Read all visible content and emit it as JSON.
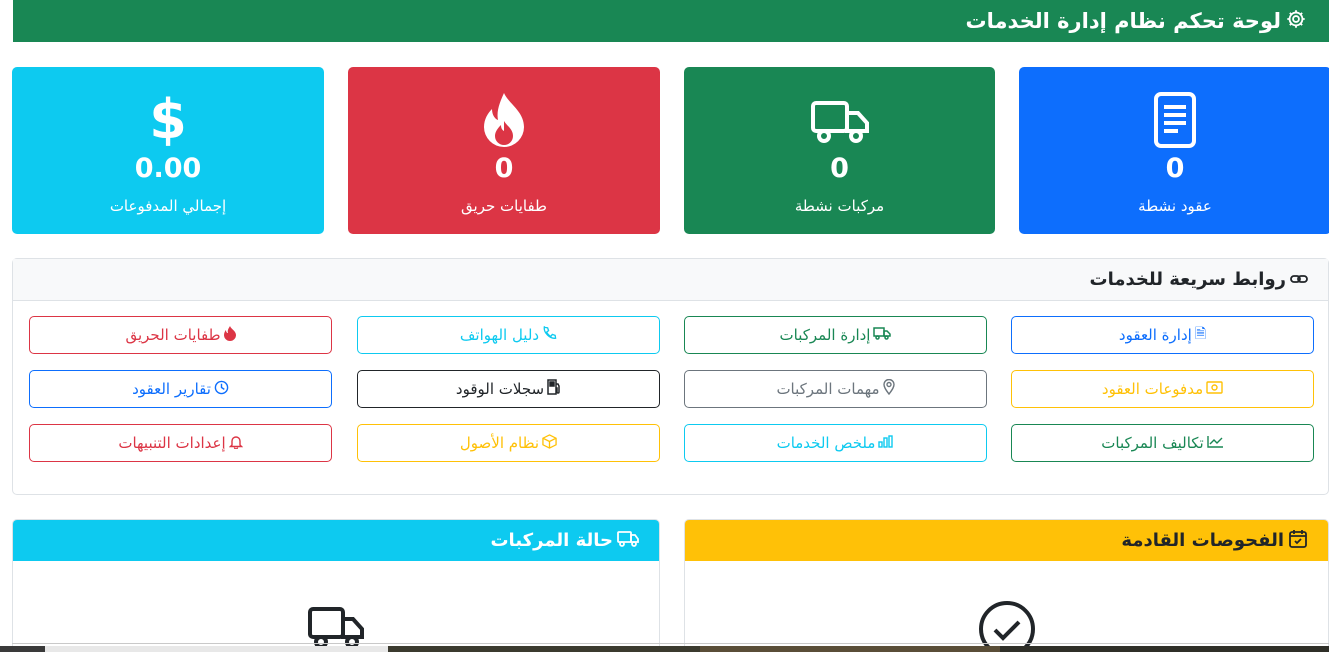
{
  "header": {
    "title": "لوحة تحكم نظام إدارة الخدمات",
    "icon": "gear-icon"
  },
  "stats": [
    {
      "id": "contracts",
      "value": "0",
      "label": "عقود نشطة",
      "icon": "document-icon",
      "color": "#0d6efd"
    },
    {
      "id": "vehicles",
      "value": "0",
      "label": "مركبات نشطة",
      "icon": "truck-icon",
      "color": "#198754"
    },
    {
      "id": "extinguishers",
      "value": "0",
      "label": "طفايات حريق",
      "icon": "fire-icon",
      "color": "#dc3545"
    },
    {
      "id": "payments",
      "value": "0.00",
      "label": "إجمالي المدفوعات",
      "icon": "dollar-icon",
      "color": "#0dcaf0"
    }
  ],
  "quick_links": {
    "title": "روابط سريعة للخدمات",
    "icon": "link-icon",
    "items": [
      {
        "label": "إدارة العقود",
        "icon": "file-text-icon",
        "color": "#0d6efd"
      },
      {
        "label": "إدارة المركبات",
        "icon": "truck-icon",
        "color": "#198754"
      },
      {
        "label": "دليل الهواتف",
        "icon": "phone-icon",
        "color": "#0dcaf0"
      },
      {
        "label": "طفايات الحريق",
        "icon": "fire-icon",
        "color": "#dc3545"
      },
      {
        "label": "مدفوعات العقود",
        "icon": "cash-icon",
        "color": "#ffc107"
      },
      {
        "label": "مهمات المركبات",
        "icon": "map-pin-icon",
        "color": "#6c757d"
      },
      {
        "label": "سجلات الوقود",
        "icon": "fuel-pump-icon",
        "color": "#212529"
      },
      {
        "label": "تقارير العقود",
        "icon": "clock-icon",
        "color": "#0d6efd"
      },
      {
        "label": "تكاليف المركبات",
        "icon": "graph-up-icon",
        "color": "#198754"
      },
      {
        "label": "ملخص الخدمات",
        "icon": "bar-chart-icon",
        "color": "#0dcaf0"
      },
      {
        "label": "نظام الأصول",
        "icon": "box-icon",
        "color": "#ffc107"
      },
      {
        "label": "إعدادات التنبيهات",
        "icon": "bell-icon",
        "color": "#dc3545"
      }
    ]
  },
  "panels": {
    "inspections": {
      "title": "الفحوصات القادمة",
      "icon": "calendar-check-icon",
      "body_icon": "check-circle-icon",
      "color": "#ffc107"
    },
    "vehicle_status": {
      "title": "حالة المركبات",
      "icon": "truck-icon",
      "body_icon": "truck-icon",
      "color": "#0dcaf0"
    }
  }
}
